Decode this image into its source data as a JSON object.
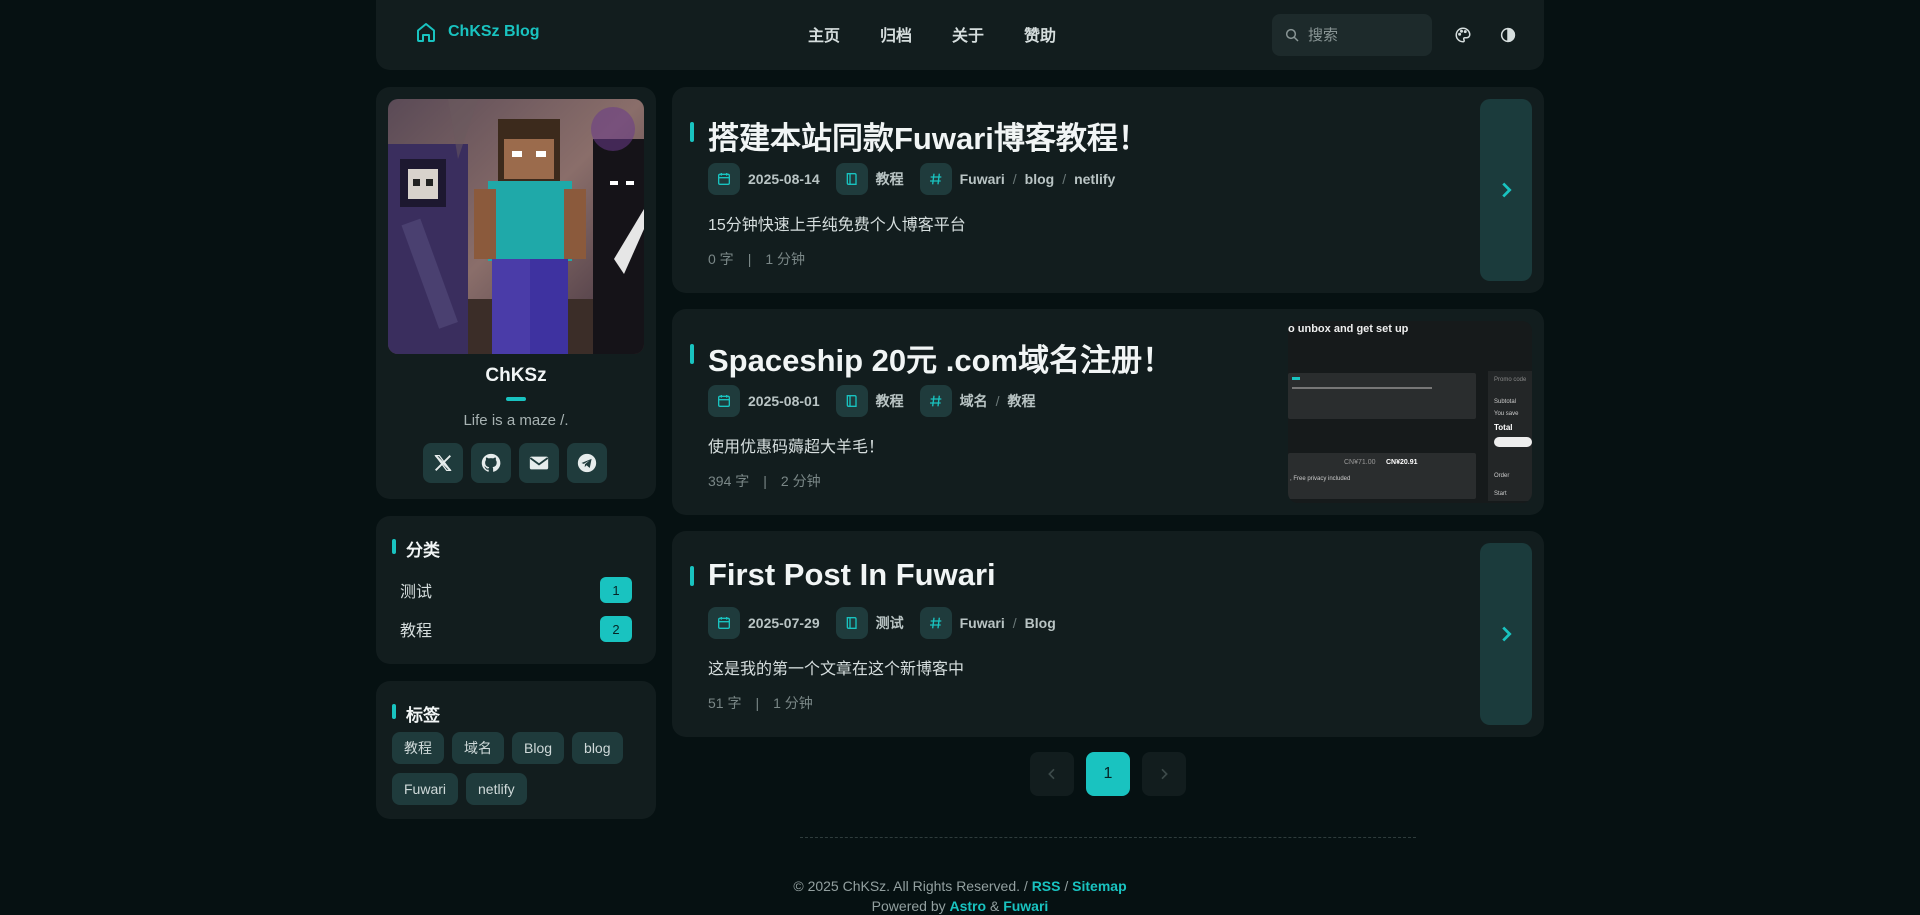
{
  "nav": {
    "brand": "ChKSz Blog",
    "links": [
      "主页",
      "归档",
      "关于",
      "赞助"
    ],
    "search_placeholder": "搜索"
  },
  "profile": {
    "name": "ChKSz",
    "bio": "Life is a maze /."
  },
  "categories": {
    "title": "分类",
    "items": [
      {
        "label": "测试",
        "count": "1"
      },
      {
        "label": "教程",
        "count": "2"
      }
    ]
  },
  "tags": {
    "title": "标签",
    "items": [
      "教程",
      "域名",
      "Blog",
      "blog",
      "Fuwari",
      "netlify"
    ]
  },
  "posts": [
    {
      "title": "搭建本站同款Fuwari博客教程！",
      "date": "2025-08-14",
      "category": "教程",
      "tags": [
        "Fuwari",
        "blog",
        "netlify"
      ],
      "desc": "15分钟快速上手纯免费个人博客平台",
      "words": "0 字",
      "time": "1 分钟"
    },
    {
      "title": "Spaceship 20元 .com域名注册！",
      "date": "2025-08-01",
      "category": "教程",
      "tags": [
        "域名",
        "教程"
      ],
      "desc": "使用优惠码薅超大羊毛！",
      "words": "394 字",
      "time": "2 分钟",
      "cover": {
        "heading": "o unbox and get set up",
        "price_old": "CN¥71.00",
        "price_new": "CN¥20.91",
        "privacy": ", Free privacy included",
        "side_labels": [
          "Promo code",
          "Subtotal",
          "You save",
          "Total",
          "Order",
          "Start"
        ]
      }
    },
    {
      "title": "First Post In Fuwari",
      "date": "2025-07-29",
      "category": "测试",
      "tags": [
        "Fuwari",
        "Blog"
      ],
      "desc": "这是我的第一个文章在这个新博客中",
      "words": "51 字",
      "time": "1 分钟"
    }
  ],
  "pagination": {
    "current": "1"
  },
  "footer": {
    "copyright": "© 2025 ChKSz. All Rights Reserved. / ",
    "rss": "RSS",
    "slash": " / ",
    "sitemap": "Sitemap",
    "powered": "Powered by ",
    "astro": "Astro",
    "amp": " & ",
    "fuwari": "Fuwari"
  },
  "colors": {
    "accent": "#19c3c0",
    "bg": "#061112",
    "card": "#121d1e"
  }
}
